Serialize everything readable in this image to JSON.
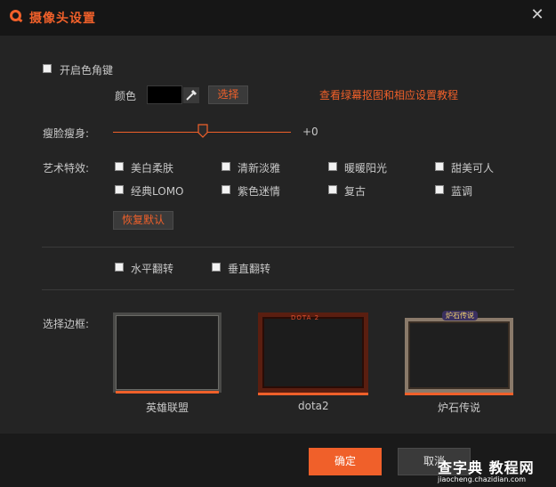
{
  "window": {
    "title": "摄像头设置"
  },
  "chroma": {
    "enable_label": "开启色角键",
    "color_label": "颜色",
    "select_button": "选择",
    "tutorial_link": "查看绿幕抠图和相应设置教程",
    "swatch_color": "#000000"
  },
  "slim": {
    "label": "瘦脸瘦身:",
    "value_text": "+0",
    "value": 0
  },
  "effects": {
    "label": "艺术特效:",
    "items": [
      "美白柔肤",
      "清新淡雅",
      "暖暖阳光",
      "甜美可人",
      "经典LOMO",
      "紫色迷情",
      "复古",
      "蓝调"
    ],
    "reset_button": "恢复默认"
  },
  "flip": {
    "horizontal": "水平翻转",
    "vertical": "垂直翻转"
  },
  "frames": {
    "label": "选择边框:",
    "items": [
      "英雄联盟",
      "dota2",
      "炉石传说"
    ],
    "dota_banner": "DOTA 2",
    "hearthstone_banner": "炉石传说"
  },
  "footer": {
    "ok": "确定",
    "cancel": "取消"
  },
  "watermark": {
    "text": "查字典 教程网",
    "url": "jiaocheng.chazidian.com"
  },
  "colors": {
    "accent": "#f0602a",
    "background": "#242424",
    "titlebar": "#161616"
  }
}
